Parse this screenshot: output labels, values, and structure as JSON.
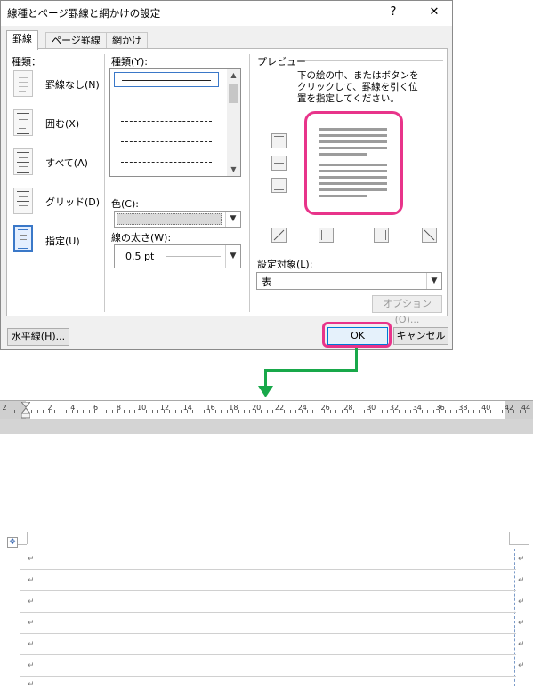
{
  "dialog": {
    "title": "線種とページ罫線と網かけの設定",
    "help_glyph": "?",
    "close_glyph": "✕",
    "tabs": [
      "罫線",
      "ページ罫線",
      "網かけ"
    ],
    "presets_label": "種類：",
    "presets": [
      "罫線なし(N)",
      "囲む(X)",
      "すべて(A)",
      "グリッド(D)",
      "指定(U)"
    ],
    "style_label": "種類(Y):",
    "color_label": "色(C):",
    "width_label": "線の太さ(W):",
    "width_value": "0.5 pt",
    "preview_label": "プレビュー",
    "preview_hint": [
      "下の絵の中、またはボタンを",
      "クリックして、罫線を引く位",
      "置を指定してください。"
    ],
    "apply_label": "設定対象(L):",
    "apply_value": "表",
    "options_button": "オプション(O)...",
    "horizontal_line_button": "水平線(H)...",
    "ok_button": "OK",
    "cancel_button": "キャンセル"
  },
  "ruler": {
    "numbers": [
      "2",
      "2",
      "4",
      "6",
      "8",
      "10",
      "12",
      "14",
      "16",
      "18",
      "20",
      "22",
      "24",
      "26",
      "28",
      "30",
      "32",
      "34",
      "36",
      "38",
      "40",
      "42",
      "44"
    ]
  },
  "document": {
    "para_mark": "↵",
    "move_handle_glyph": "✥"
  },
  "colors": {
    "highlight": "#e8348a",
    "arrow": "#18a84a",
    "selection": "#3a78c8"
  }
}
